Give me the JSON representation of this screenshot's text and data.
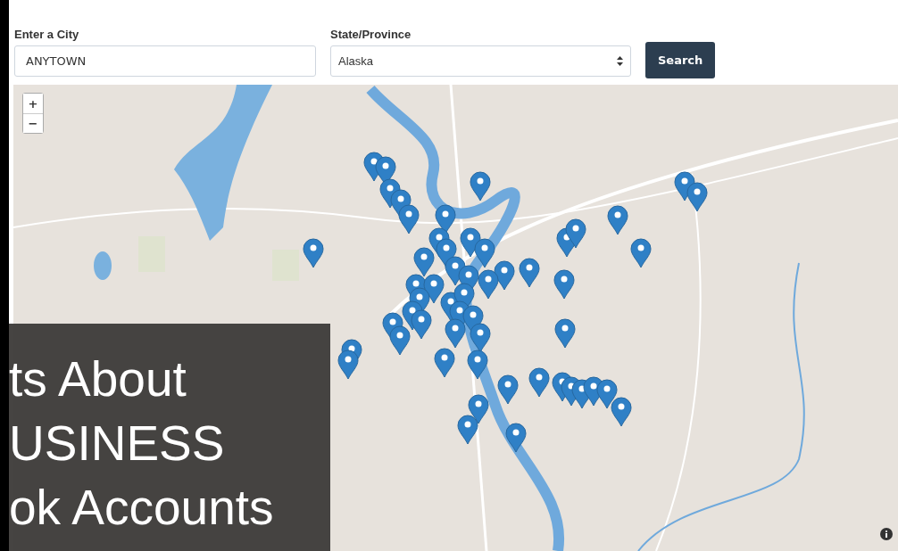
{
  "form": {
    "city": {
      "label": "Enter a City",
      "value": "ANYTOWN"
    },
    "state": {
      "label": "State/Province",
      "value": "Alaska"
    },
    "button": "Search"
  },
  "map": {
    "zoom_in": "+",
    "zoom_out": "−"
  },
  "overlay": {
    "lines": [
      "ts About",
      "USINESS",
      "ok Accounts"
    ]
  }
}
